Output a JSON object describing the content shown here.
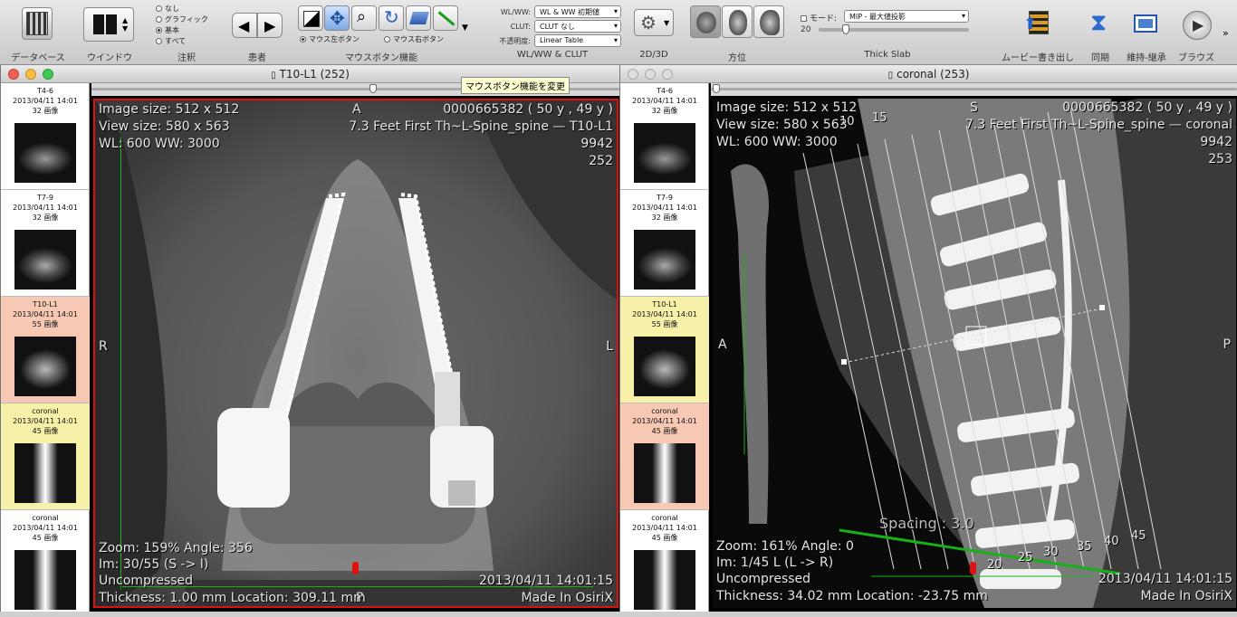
{
  "toolbar": {
    "database_label": "データベース",
    "window_label": "ウインドウ",
    "annotation_label": "注釈",
    "annotation_options": [
      "なし",
      "グラフィック",
      "基本",
      "すべて"
    ],
    "annotation_selected": "基本",
    "patient_label": "患者",
    "mouse_label": "マウスボタン機能",
    "mouse_left_radio": "マウス左ボタン",
    "mouse_right_radio": "マウス右ボタン",
    "wlww_label": "WL/WW:",
    "wlww_value": "WL & WW 初期値",
    "clut_label": "CLUT:",
    "clut_value": "CLUT なし",
    "opacity_label": "不透明度:",
    "opacity_value": "Linear Table",
    "wlww_group_label": "WL/WW & CLUT",
    "view2d3d_label": "2D/3D",
    "orientation_label": "方位",
    "mode_label": "モード:",
    "mode_value": "MIP - 最大値投影",
    "slab_value": "20",
    "thickslab_label": "Thick Slab",
    "movie_label": "ムービー書き出し",
    "sync_label": "同期",
    "keep_label": "維持-継承",
    "browse_label": "ブラウズ"
  },
  "left_window": {
    "title": "T10-L1 (252)",
    "tooltip": "マウスボタン機能を変更",
    "slider_pos": 0.5,
    "thumbnails": [
      {
        "title": "T4-6",
        "date": "2013/04/11 14:01",
        "count": "32 画像",
        "state": "normal"
      },
      {
        "title": "T7-9",
        "date": "2013/04/11 14:01",
        "count": "32 画像",
        "state": "normal"
      },
      {
        "title": "T10-L1",
        "date": "2013/04/11 14:01",
        "count": "55 画像",
        "state": "active"
      },
      {
        "title": "coronal",
        "date": "2013/04/11 14:01",
        "count": "45 画像",
        "state": "linked"
      },
      {
        "title": "coronal",
        "date": "2013/04/11 14:01",
        "count": "45 画像",
        "state": "normal"
      }
    ],
    "overlay": {
      "image_size": "Image size: 512 x 512",
      "view_size": "View size: 580 x 563",
      "wl": "WL: 600 WW: 3000",
      "orient_top": "A",
      "orient_left": "R",
      "orient_right": "L",
      "orient_bottom": "P",
      "patient_id": "0000665382 ( 50 y , 49 y )",
      "study": "7.3 Feet First Th~L-Spine_spine — T10-L1",
      "series_num": "9942",
      "image_num": "252",
      "zoom": "Zoom: 159% Angle: 356",
      "im": "Im: 30/55  (S -> I)",
      "compression": "Uncompressed",
      "thickness": "Thickness: 1.00 mm Location: 309.11 mm",
      "datetime": "2013/04/11 14:01:15",
      "made_in": "Made In OsiriX"
    }
  },
  "right_window": {
    "title": "coronal (253)",
    "slider_pos": 0.0,
    "thumbnails": [
      {
        "title": "T4-6",
        "date": "2013/04/11 14:01",
        "count": "32 画像",
        "state": "normal"
      },
      {
        "title": "T7-9",
        "date": "2013/04/11 14:01",
        "count": "32 画像",
        "state": "normal"
      },
      {
        "title": "T10-L1",
        "date": "2013/04/11 14:01",
        "count": "55 画像",
        "state": "linked"
      },
      {
        "title": "coronal",
        "date": "2013/04/11 14:01",
        "count": "45 画像",
        "state": "active"
      },
      {
        "title": "coronal",
        "date": "2013/04/11 14:01",
        "count": "45 画像",
        "state": "normal"
      }
    ],
    "overlay": {
      "image_size": "Image size: 512 x 512",
      "view_size": "View size: 580 x 563",
      "wl": "WL: 600 WW: 3000",
      "orient_top": "S",
      "orient_left": "A",
      "orient_right": "P",
      "patient_id": "0000665382 ( 50 y , 49 y )",
      "study": "7.3 Feet First Th~L-Spine_spine — coronal",
      "series_num": "9942",
      "image_num": "253",
      "zoom": "Zoom: 161% Angle: 0",
      "im": "Im: 1/45  L (L -> R)",
      "compression": "Uncompressed",
      "thickness": "Thickness: 34.02 mm Location: -23.75 mm",
      "datetime": "2013/04/11 14:01:15",
      "made_in": "Made In OsiriX",
      "spacing": "Spacing : 3.0",
      "slice_numbers": [
        "10",
        "15",
        "20",
        "25",
        "30",
        "35",
        "40",
        "45"
      ]
    }
  },
  "colors": {
    "active_thumb": "#f7c9b4",
    "linked_thumb": "#f7f0a8",
    "active_border": "#e01010",
    "ruler": "#18b018"
  }
}
